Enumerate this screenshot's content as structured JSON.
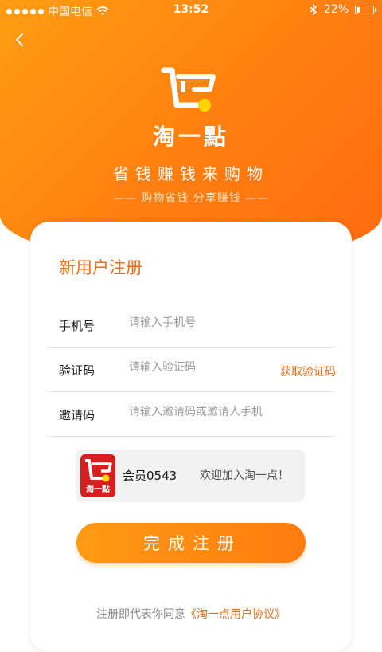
{
  "status_bar": {
    "carrier": "中国电信",
    "time": "13:52",
    "battery": "22%",
    "battery_level": 0.22
  },
  "header": {
    "brand": "淘一點",
    "slogan": "省钱赚钱来购物",
    "subtitle": "—— 购物省钱  分享赚钱 ——"
  },
  "form": {
    "title": "新用户注册",
    "phone": {
      "label": "手机号",
      "placeholder": "请输入手机号"
    },
    "code": {
      "label": "验证码",
      "placeholder": "请输入验证码",
      "action": "获取验证码"
    },
    "invite": {
      "label": "邀请码",
      "placeholder": "请输入邀请码或邀请人手机"
    },
    "notice": {
      "avatar_text": "淘一點",
      "member": "会员0543",
      "welcome": "欢迎加入淘一点！"
    },
    "submit": "完成注册",
    "agreement_prefix": "注册即代表你同意",
    "agreement_link": "《淘一点用户协议》"
  },
  "colors": {
    "primary": "#ff8a12",
    "accent_text": "#f26a12",
    "avatar": "#d81e1e",
    "logo_dot": "#ffd500"
  },
  "icons": [
    "back-icon",
    "wifi-icon",
    "bluetooth-icon",
    "battery-icon",
    "cart-logo-icon"
  ]
}
